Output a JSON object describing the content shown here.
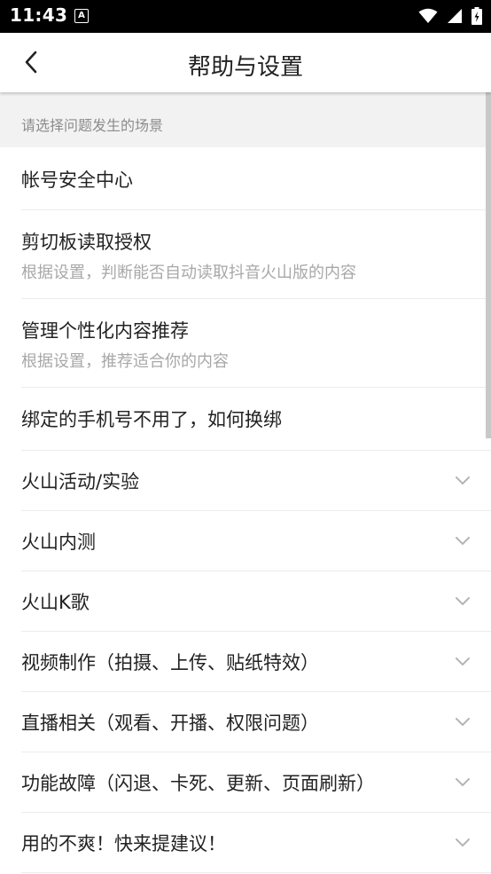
{
  "status_bar": {
    "time": "11:43",
    "notification_glyph": "A",
    "icons": [
      "wifi-icon",
      "signal-icon",
      "battery-icon"
    ]
  },
  "header": {
    "title": "帮助与设置",
    "back_icon": "chevron-left-icon"
  },
  "section": {
    "label": "请选择问题发生的场景"
  },
  "items": [
    {
      "title": "帐号安全中心",
      "subtitle": "",
      "expandable": false
    },
    {
      "title": "剪切板读取授权",
      "subtitle": "根据设置，判断能否自动读取抖音火山版的内容",
      "expandable": false
    },
    {
      "title": "管理个性化内容推荐",
      "subtitle": "根据设置，推荐适合你的内容",
      "expandable": false
    },
    {
      "title": "绑定的手机号不用了，如何换绑",
      "subtitle": "",
      "expandable": false
    },
    {
      "title": "火山活动/实验",
      "subtitle": "",
      "expandable": true
    },
    {
      "title": "火山内测",
      "subtitle": "",
      "expandable": true
    },
    {
      "title": "火山K歌",
      "subtitle": "",
      "expandable": true
    },
    {
      "title": "视频制作（拍摄、上传、贴纸特效）",
      "subtitle": "",
      "expandable": true
    },
    {
      "title": "直播相关（观看、开播、权限问题）",
      "subtitle": "",
      "expandable": true
    },
    {
      "title": "功能故障（闪退、卡死、更新、页面刷新）",
      "subtitle": "",
      "expandable": true
    },
    {
      "title": "用的不爽！快来提建议！",
      "subtitle": "",
      "expandable": true
    }
  ],
  "colors": {
    "status_bar_bg": "#000000",
    "section_bg": "#f2f2f2",
    "title_text": "#222222",
    "subtitle_text": "#a8a8a8",
    "divider": "#ececec"
  }
}
